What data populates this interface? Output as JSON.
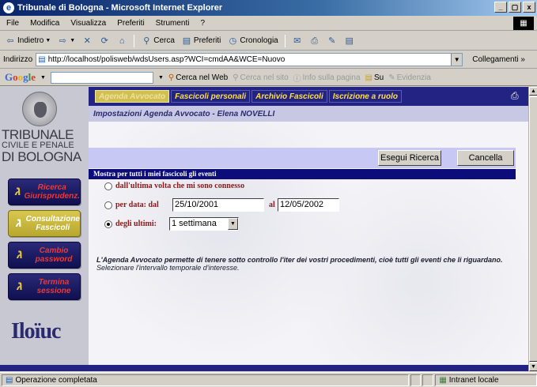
{
  "window": {
    "title": "Tribunale di Bologna - Microsoft Internet Explorer",
    "buttons": [
      "_",
      "đ",
      "x"
    ]
  },
  "menu": [
    "File",
    "Modifica",
    "Visualizza",
    "Preferiti",
    "Strumenti",
    "?"
  ],
  "toolbar": {
    "back": "Indietro",
    "search": "Cerca",
    "favorites": "Preferiti",
    "history": "Cronologia"
  },
  "address": {
    "label": "Indirizzo",
    "url": "http://localhost/polisweb/wdsUsers.asp?WCI=cmdAA&WCE=Nuovo",
    "links": "Collegamenti »"
  },
  "google": {
    "logo": "Google",
    "search_web": "Cerca nel Web",
    "search_site": "Cerca nel sito",
    "page_info": "Info sulla pagina",
    "up": "Su",
    "highlight": "Evidenzia"
  },
  "sidebar": {
    "brand_line1": "TRIBUNALE",
    "brand_line2": "CIVILE E PENALE",
    "brand_line3": "DI BOLOGNA",
    "items": [
      {
        "label": "Ricerca Giurisprudenz."
      },
      {
        "label": "Consultazione Fascicoli"
      },
      {
        "label": "Cambio password"
      },
      {
        "label": "Termina sessione"
      }
    ],
    "bottom_logo": "Iloïuc"
  },
  "tabs": [
    "Agenda Avvocato",
    "Fascicoli personali",
    "Archivio Fascicoli",
    "Iscrizione a ruolo"
  ],
  "page_title": "Impostazioni Agenda Avvocato - Elena NOVELLI",
  "buttons": {
    "search": "Esegui Ricerca",
    "cancel": "Cancella"
  },
  "section_header": "Mostra per tutti i miei fascicoli gli eventi",
  "options": {
    "since_last": "dall'ultima volta che mi sono connesso",
    "by_date_prefix": "per data:  dal",
    "date_from": "25/10/2001",
    "date_to_label": "al",
    "date_to": "12/05/2002",
    "last_prefix": "degli ultimi:",
    "last_value": "1 settimana"
  },
  "info": {
    "line1": "L'Agenda Avvocato permette di tenere sotto controllo l'iter dei vostri procedimenti, cioè tutti gli eventi che li riguardano.",
    "line2": "Selezionare l'intervallo temporale d'interesse."
  },
  "status": {
    "text": "Operazione completata",
    "zone": "Intranet locale"
  }
}
